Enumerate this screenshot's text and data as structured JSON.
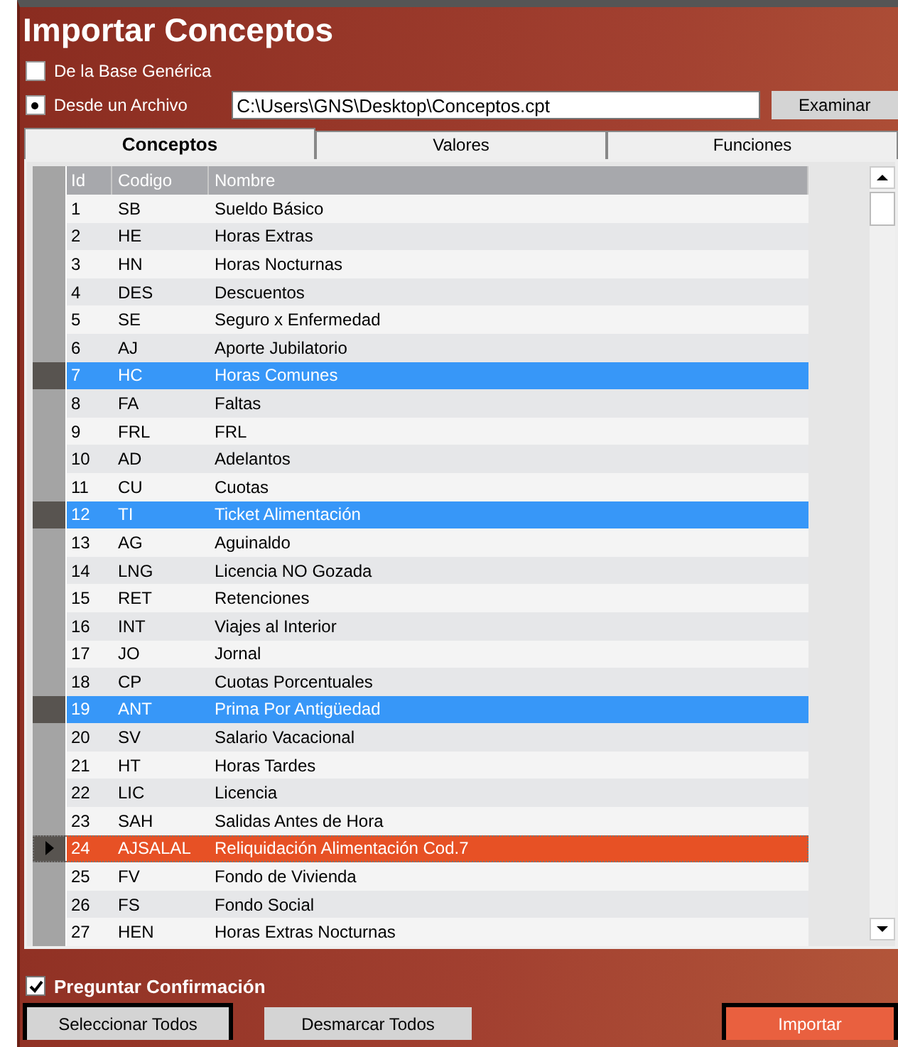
{
  "window": {
    "title": "Importar Conceptos"
  },
  "source_options": [
    {
      "label": "De la Base Genérica",
      "selected": false
    },
    {
      "label": "Desde un Archivo",
      "selected": true
    }
  ],
  "file_path": {
    "value": "C:\\Users\\GNS\\Desktop\\Conceptos.cpt"
  },
  "browse_button": "Examinar",
  "tabs": [
    {
      "label": "Conceptos",
      "selected": true
    },
    {
      "label": "Valores",
      "selected": false
    },
    {
      "label": "Funciones",
      "selected": false
    }
  ],
  "table": {
    "columns": [
      "Id",
      "Codigo",
      "Nombre"
    ],
    "rows": [
      {
        "id": "1",
        "code": "SB",
        "name": "Sueldo Básico",
        "selected": false,
        "current": false
      },
      {
        "id": "2",
        "code": "HE",
        "name": "Horas Extras",
        "selected": false,
        "current": false
      },
      {
        "id": "3",
        "code": "HN",
        "name": "Horas Nocturnas",
        "selected": false,
        "current": false
      },
      {
        "id": "4",
        "code": "DES",
        "name": "Descuentos",
        "selected": false,
        "current": false
      },
      {
        "id": "5",
        "code": "SE",
        "name": "Seguro x Enfermedad",
        "selected": false,
        "current": false
      },
      {
        "id": "6",
        "code": "AJ",
        "name": "Aporte Jubilatorio",
        "selected": false,
        "current": false
      },
      {
        "id": "7",
        "code": "HC",
        "name": "Horas Comunes",
        "selected": true,
        "current": false
      },
      {
        "id": "8",
        "code": "FA",
        "name": "Faltas",
        "selected": false,
        "current": false
      },
      {
        "id": "9",
        "code": "FRL",
        "name": "FRL",
        "selected": false,
        "current": false
      },
      {
        "id": "10",
        "code": "AD",
        "name": "Adelantos",
        "selected": false,
        "current": false
      },
      {
        "id": "11",
        "code": "CU",
        "name": "Cuotas",
        "selected": false,
        "current": false
      },
      {
        "id": "12",
        "code": "TI",
        "name": "Ticket Alimentación",
        "selected": true,
        "current": false
      },
      {
        "id": "13",
        "code": "AG",
        "name": "Aguinaldo",
        "selected": false,
        "current": false
      },
      {
        "id": "14",
        "code": "LNG",
        "name": "Licencia NO Gozada",
        "selected": false,
        "current": false
      },
      {
        "id": "15",
        "code": "RET",
        "name": "Retenciones",
        "selected": false,
        "current": false
      },
      {
        "id": "16",
        "code": "INT",
        "name": "Viajes al Interior",
        "selected": false,
        "current": false
      },
      {
        "id": "17",
        "code": "JO",
        "name": "Jornal",
        "selected": false,
        "current": false
      },
      {
        "id": "18",
        "code": "CP",
        "name": "Cuotas Porcentuales",
        "selected": false,
        "current": false
      },
      {
        "id": "19",
        "code": "ANT",
        "name": "Prima Por Antigüedad",
        "selected": true,
        "current": false
      },
      {
        "id": "20",
        "code": "SV",
        "name": "Salario Vacacional",
        "selected": false,
        "current": false
      },
      {
        "id": "21",
        "code": "HT",
        "name": "Horas Tardes",
        "selected": false,
        "current": false
      },
      {
        "id": "22",
        "code": "LIC",
        "name": "Licencia",
        "selected": false,
        "current": false
      },
      {
        "id": "23",
        "code": "SAH",
        "name": "Salidas Antes de Hora",
        "selected": false,
        "current": false
      },
      {
        "id": "24",
        "code": "AJSALAL",
        "name": "Reliquidación Alimentación Cod.7",
        "selected": false,
        "current": true
      },
      {
        "id": "25",
        "code": "FV",
        "name": "Fondo de Vivienda",
        "selected": false,
        "current": false
      },
      {
        "id": "26",
        "code": "FS",
        "name": "Fondo Social",
        "selected": false,
        "current": false
      },
      {
        "id": "27",
        "code": "HEN",
        "name": "Horas Extras Nocturnas",
        "selected": false,
        "current": false
      }
    ]
  },
  "confirm": {
    "label": "Preguntar Confirmación",
    "checked": true
  },
  "buttons": [
    {
      "label": "Seleccionar Todos",
      "kind": "framed"
    },
    {
      "label": "Desmarcar Todos",
      "kind": "plain"
    },
    {
      "label": "Importar",
      "kind": "primary"
    }
  ]
}
